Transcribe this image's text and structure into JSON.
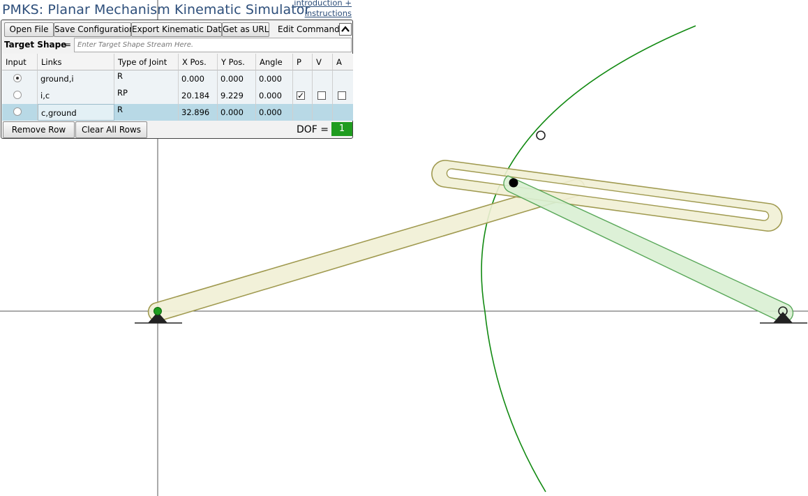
{
  "app": {
    "title": "PMKS: Planar Mechanism Kinematic Simulator",
    "intro_link_line1": "introduction +",
    "intro_link_line2": "instructions"
  },
  "toolbar": {
    "open_file": "Open File",
    "save_config": "Save Configuration",
    "export_data": "Export Kinematic Data",
    "get_url": "Get as URL",
    "edit_commands": "Edit Commands"
  },
  "target": {
    "label": "Target Shape",
    "eq": "=",
    "placeholder": "Enter Target Shape Stream Here."
  },
  "table": {
    "headers": [
      "Input",
      "Links",
      "Type of Joint",
      "X Pos.",
      "Y Pos.",
      "Angle",
      "P",
      "V",
      "A"
    ],
    "rows": [
      {
        "input_selected": true,
        "links": "ground,i",
        "type": "R",
        "x": "0.000",
        "y": "0.000",
        "angle": "0.000",
        "show_pva": false
      },
      {
        "input_selected": false,
        "links": "i,c",
        "type": "RP",
        "x": "20.184",
        "y": "9.229",
        "angle": "0.000",
        "show_pva": true,
        "p": true,
        "v": false,
        "a": false
      },
      {
        "input_selected": false,
        "links": "c,ground",
        "type": "R",
        "x": "32.896",
        "y": "0.000",
        "angle": "0.000",
        "show_pva": false
      }
    ]
  },
  "bottom": {
    "remove_row": "Remove Row",
    "clear_rows": "Clear All Rows",
    "dof_label": "DOF =",
    "dof_value": "1"
  },
  "colors": {
    "link_fill": "#f1f0d5",
    "link_stroke": "#a09a50",
    "green_link_fill": "#d9f0d3",
    "green_stroke": "#5aa85a",
    "path_green": "#128a12",
    "selected_row": "#b8d9e6",
    "dof_green": "#1f9c1f"
  }
}
